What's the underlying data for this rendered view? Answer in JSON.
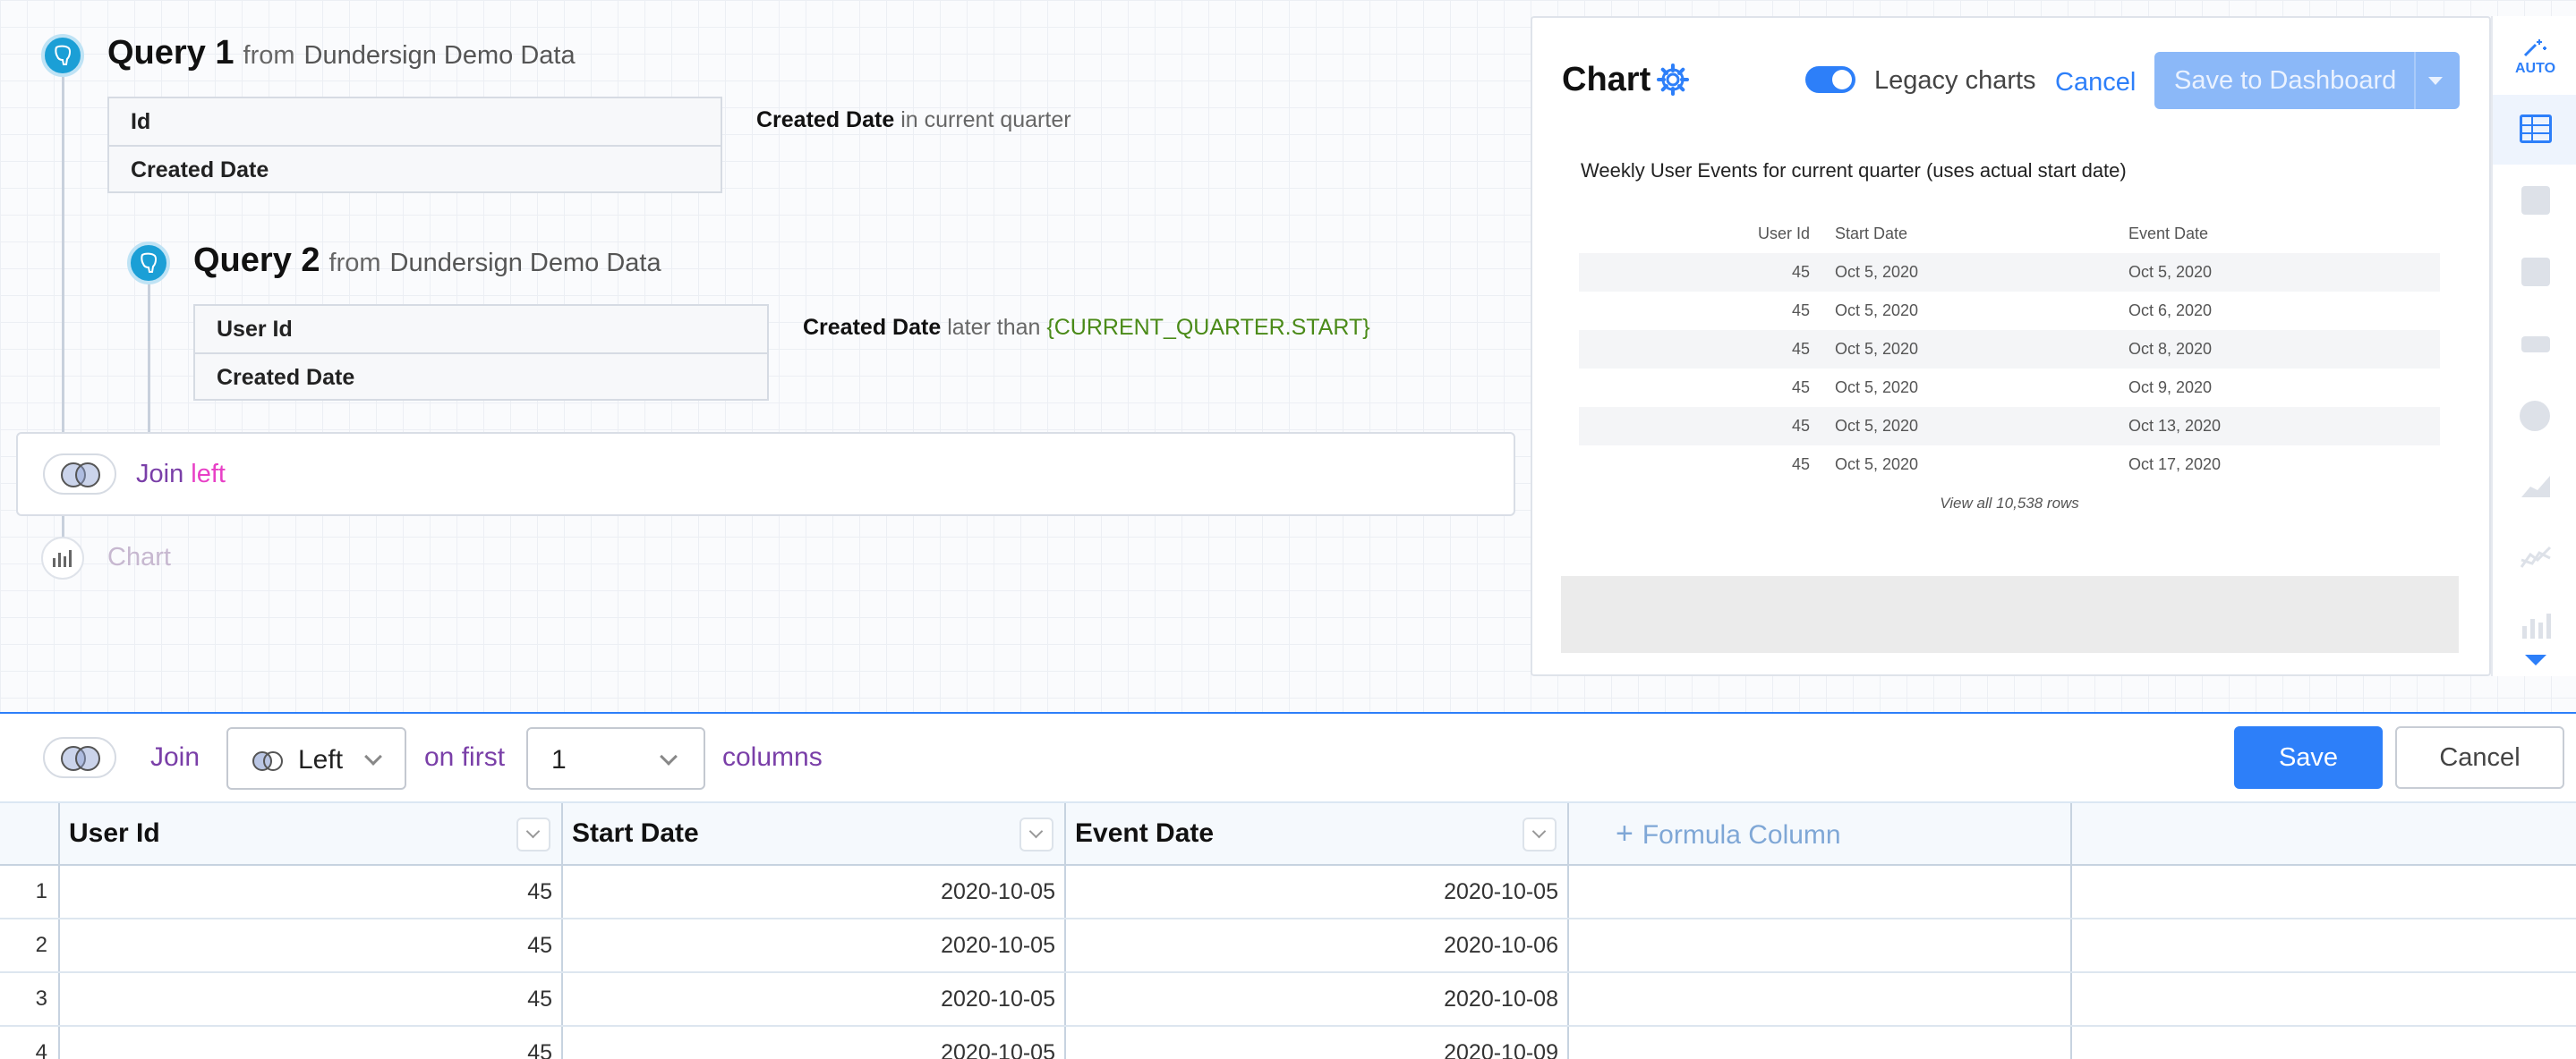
{
  "query1": {
    "title": "Query 1",
    "from_word": "from",
    "source": "Dundersign Demo Data",
    "fields": [
      "Id",
      "Created Date"
    ],
    "filter": {
      "field": "Created Date",
      "op": "in current quarter"
    }
  },
  "query2": {
    "title": "Query 2",
    "from_word": "from",
    "source": "Dundersign Demo Data",
    "fields": [
      "User Id",
      "Created Date"
    ],
    "filter": {
      "field": "Created Date",
      "op": "later than",
      "value": "{CURRENT_QUARTER.START}"
    }
  },
  "join_step": {
    "label": "Join",
    "type": "left"
  },
  "chart_step": {
    "label": "Chart"
  },
  "chart_panel": {
    "title": "Chart",
    "legacy_label": "Legacy charts",
    "legacy_on": true,
    "cancel": "Cancel",
    "save_dashboard": "Save to Dashboard",
    "preview_title": "Weekly User Events for current quarter (uses actual start date)",
    "columns": [
      "User Id",
      "Start Date",
      "Event Date"
    ],
    "rows": [
      [
        "45",
        "Oct 5, 2020",
        "Oct 5, 2020"
      ],
      [
        "45",
        "Oct 5, 2020",
        "Oct 6, 2020"
      ],
      [
        "45",
        "Oct 5, 2020",
        "Oct 8, 2020"
      ],
      [
        "45",
        "Oct 5, 2020",
        "Oct 9, 2020"
      ],
      [
        "45",
        "Oct 5, 2020",
        "Oct 13, 2020"
      ],
      [
        "45",
        "Oct 5, 2020",
        "Oct 17, 2020"
      ]
    ],
    "view_all": "View all 10,538 rows"
  },
  "rail": {
    "auto_label": "AUTO",
    "icons": [
      "magic-auto-icon",
      "table-icon",
      "number-icon",
      "number-compare-icon",
      "progress-icon",
      "pie-icon",
      "area-icon",
      "line-icon",
      "bar-icon",
      "scroll-down-icon"
    ]
  },
  "join_toolbar": {
    "join_label": "Join",
    "type_value": "Left",
    "on_first": "on first",
    "count_value": "1",
    "columns_word": "columns",
    "save": "Save",
    "cancel": "Cancel"
  },
  "grid": {
    "columns": [
      "User Id",
      "Start Date",
      "Event Date"
    ],
    "formula_label": "Formula Column",
    "rows": [
      {
        "n": "1",
        "user_id": "45",
        "start": "2020-10-05",
        "event": "2020-10-05"
      },
      {
        "n": "2",
        "user_id": "45",
        "start": "2020-10-05",
        "event": "2020-10-06"
      },
      {
        "n": "3",
        "user_id": "45",
        "start": "2020-10-05",
        "event": "2020-10-08"
      },
      {
        "n": "4",
        "user_id": "45",
        "start": "2020-10-05",
        "event": "2020-10-09"
      }
    ]
  },
  "colors": {
    "accent": "#2d7ff9",
    "join_purple": "#7a3fa8",
    "join_pink": "#e83fc6",
    "postgres_blue": "#1b9fd6",
    "var_green": "#4a8a18"
  }
}
